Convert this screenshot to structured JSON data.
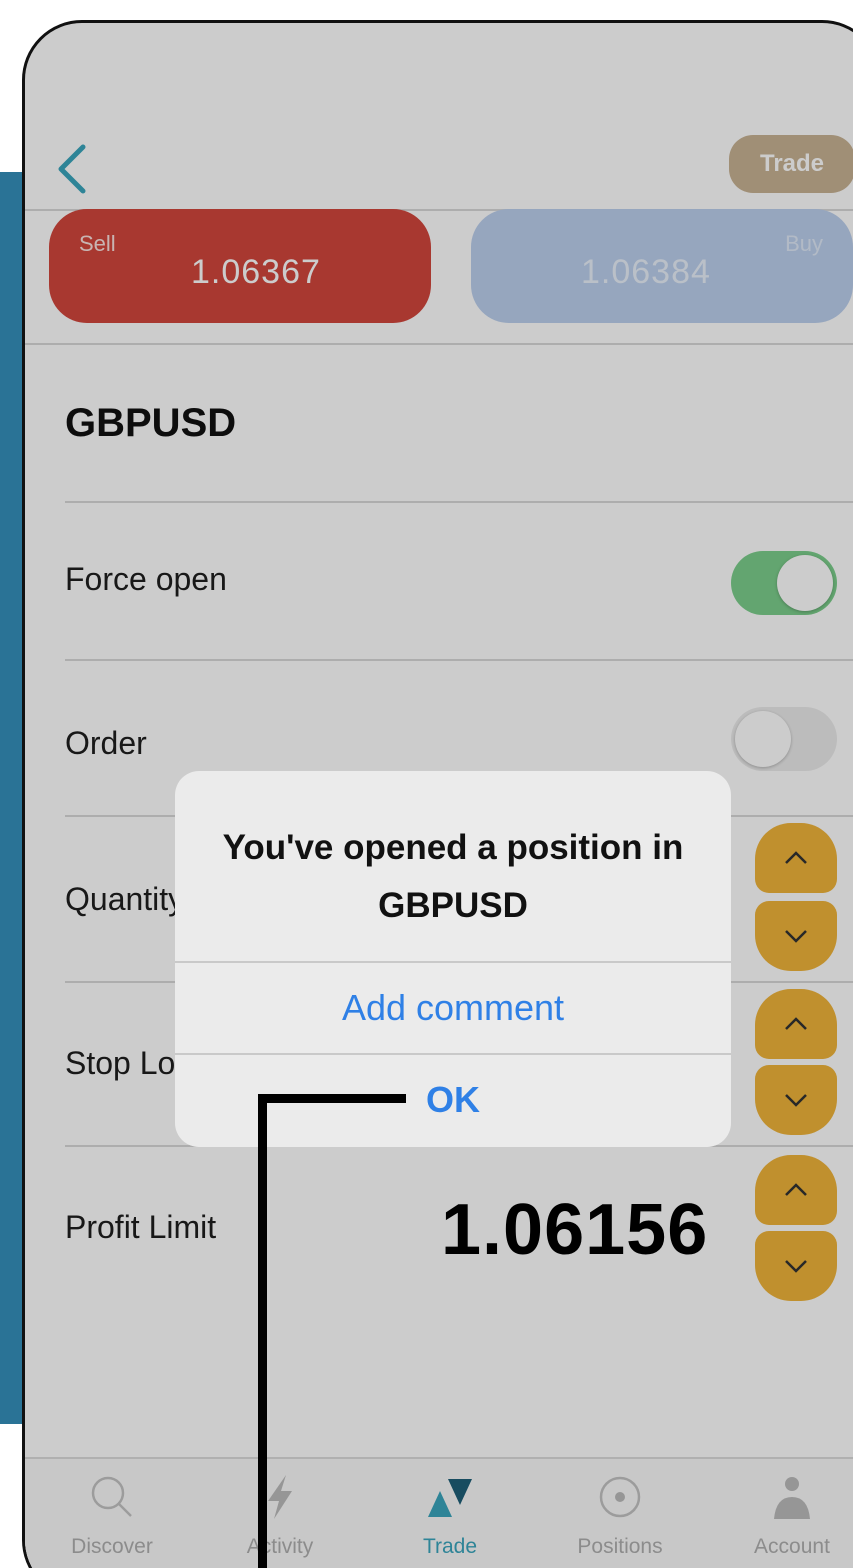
{
  "header": {
    "action_label": "Trade"
  },
  "quotes": {
    "sell": {
      "label": "Sell",
      "value": "1.06367"
    },
    "buy": {
      "label": "Buy",
      "value": "1.06384"
    }
  },
  "instrument": {
    "symbol": "GBPUSD"
  },
  "form": {
    "force_open": {
      "label": "Force open",
      "enabled": true
    },
    "order": {
      "label": "Order",
      "enabled": false
    },
    "quantity": {
      "label": "Quantity"
    },
    "stop_loss": {
      "label": "Stop Loss"
    },
    "profit_limit": {
      "label": "Profit Limit",
      "value": "1.06156"
    }
  },
  "tabs": [
    {
      "label": "Discover",
      "icon": "search-icon",
      "active": false
    },
    {
      "label": "Activity",
      "icon": "lightning-icon",
      "active": false
    },
    {
      "label": "Trade",
      "icon": "trade-triangles-icon",
      "active": true
    },
    {
      "label": "Positions",
      "icon": "target-icon",
      "active": false
    },
    {
      "label": "Account",
      "icon": "person-icon",
      "active": false
    }
  ],
  "dialog": {
    "message": "You've opened a position in GBPUSD",
    "add_comment_label": "Add comment",
    "ok_label": "OK"
  },
  "colors": {
    "sell": "#d2473d",
    "buy": "#bcd0ee",
    "stepper": "#f0b43a",
    "toggle_on": "#7ccf8c",
    "accent": "#3aa6bd",
    "link": "#2f80e6",
    "side_band": "#2a7396"
  }
}
